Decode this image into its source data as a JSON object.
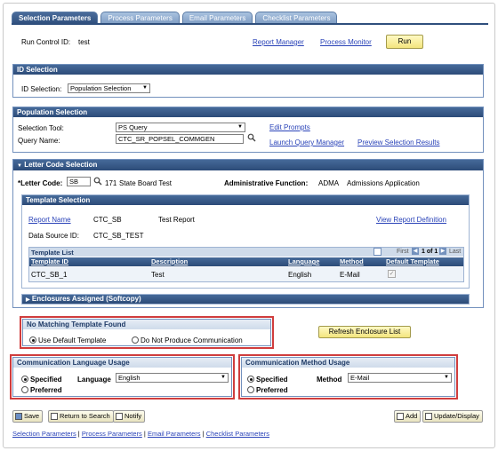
{
  "tabs": [
    "Selection Parameters",
    "Process Parameters",
    "Email Parameters",
    "Checklist Parameters"
  ],
  "header": {
    "run_control_label": "Run Control ID:",
    "run_control_value": "test",
    "report_manager": "Report Manager",
    "process_monitor": "Process Monitor",
    "run_button": "Run"
  },
  "id_selection": {
    "title": "ID Selection",
    "label": "ID Selection:",
    "value": "Population Selection"
  },
  "population_selection": {
    "title": "Population Selection",
    "tool_label": "Selection Tool:",
    "tool_value": "PS Query",
    "query_label": "Query Name:",
    "query_value": "CTC_SR_POPSEL_COMMGEN",
    "edit_prompts": "Edit Prompts",
    "launch_query_manager": "Launch Query Manager",
    "preview_selection_results": "Preview Selection Results"
  },
  "letter_code": {
    "title": "Letter Code Selection",
    "label": "*Letter Code:",
    "value": "SB",
    "code_number": "171",
    "code_desc": "State Board Test",
    "admin_function_label": "Administrative Function:",
    "admin_function_code": "ADMA",
    "admin_function_desc": "Admissions Application"
  },
  "template_selection": {
    "title": "Template Selection",
    "report_name_label": "Report Name",
    "report_name_value": "CTC_SB",
    "report_desc": "Test Report",
    "view_report_definition": "View Report Definition",
    "data_source_label": "Data Source ID:",
    "data_source_value": "CTC_SB_TEST"
  },
  "template_list": {
    "title": "Template List",
    "nav_first": "First",
    "nav_count": "1 of 1",
    "nav_last": "Last",
    "columns": [
      "Template ID",
      "Description",
      "Language",
      "Method",
      "Default Template"
    ],
    "rows": [
      {
        "template_id": "CTC_SB_1",
        "description": "Test",
        "language": "English",
        "method": "E-Mail",
        "default": true
      }
    ]
  },
  "enclosures": {
    "title": "Enclosures Assigned (Softcopy)"
  },
  "no_match": {
    "title": "No Matching Template Found",
    "option_default": "Use Default Template",
    "option_none": "Do Not Produce Communication",
    "refresh_button": "Refresh Enclosure List"
  },
  "comm_language": {
    "title": "Communication Language Usage",
    "specified": "Specified",
    "preferred": "Preferred",
    "language_label": "Language",
    "language_value": "English"
  },
  "comm_method": {
    "title": "Communication Method Usage",
    "specified": "Specified",
    "preferred": "Preferred",
    "method_label": "Method",
    "method_value": "E-Mail"
  },
  "toolbar": {
    "save": "Save",
    "return_to_search": "Return to Search",
    "notify": "Notify",
    "add": "Add",
    "update_display": "Update/Display"
  },
  "footer_links": [
    "Selection Parameters",
    "Process Parameters",
    "Email Parameters",
    "Checklist Parameters"
  ],
  "colors": {
    "accent": "#2f4f7d",
    "link": "#2a43b8",
    "highlight_box": "#d03d3d",
    "button": "#f3e57d"
  }
}
